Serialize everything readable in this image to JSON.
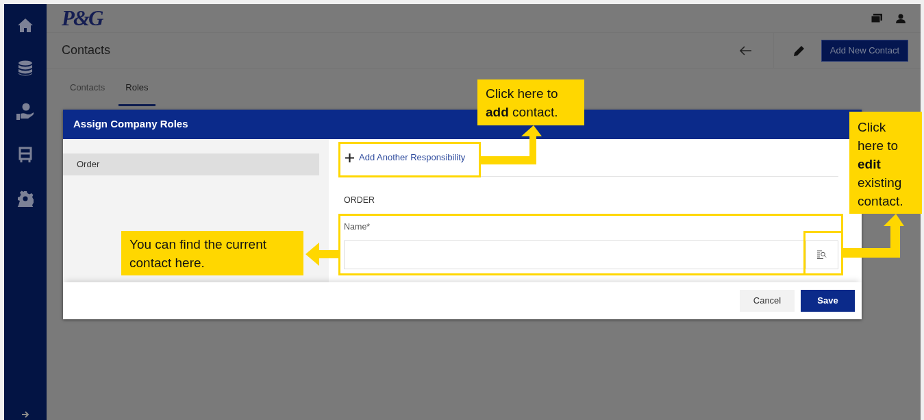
{
  "header": {
    "logo": "P&G"
  },
  "page": {
    "title": "Contacts",
    "primary_button": "Add New Contact"
  },
  "tabs": [
    {
      "label": "Contacts",
      "selected": false
    },
    {
      "label": "Roles",
      "selected": true
    }
  ],
  "dialog": {
    "title": "Assign Company Roles",
    "roles": [
      {
        "label": "Order",
        "selected": true
      }
    ],
    "add_link": "Add Another Responsibility",
    "section": "ORDER",
    "field": {
      "label": "Name*"
    },
    "buttons": [
      {
        "label": "Cancel",
        "kind": "secondary"
      },
      {
        "label": "Save",
        "kind": "primary"
      }
    ]
  },
  "callouts": [
    {
      "text": "Click here to **add** contact."
    },
    {
      "text": "Click here to **edit** existing contact."
    },
    {
      "text": "You can find the current contact here."
    }
  ]
}
